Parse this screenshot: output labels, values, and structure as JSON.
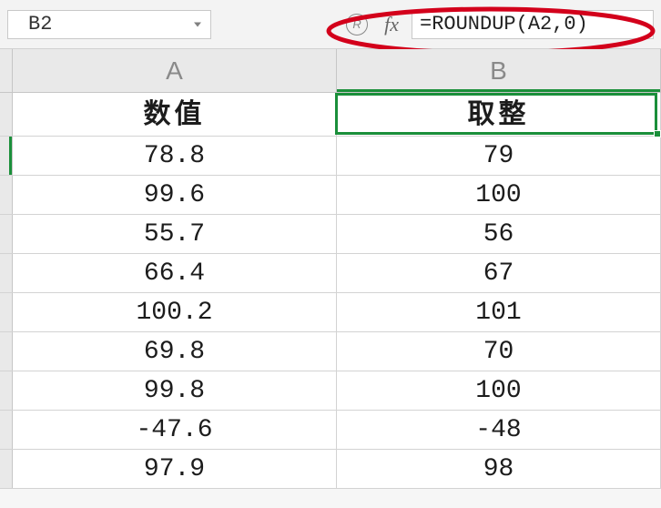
{
  "namebox": {
    "value": "B2"
  },
  "formula": {
    "value": "=ROUNDUP(A2,0)"
  },
  "icons": {
    "r": "R",
    "fx": "fx"
  },
  "columns": [
    "A",
    "B"
  ],
  "selected_column_index": 1,
  "selected_row_index": 1,
  "table_headers": {
    "A": "数值",
    "B": "取整"
  },
  "rows": [
    {
      "A": "78.8",
      "B": "79"
    },
    {
      "A": "99.6",
      "B": "100"
    },
    {
      "A": "55.7",
      "B": "56"
    },
    {
      "A": "66.4",
      "B": "67"
    },
    {
      "A": "100.2",
      "B": "101"
    },
    {
      "A": "69.8",
      "B": "70"
    },
    {
      "A": "99.8",
      "B": "100"
    },
    {
      "A": "-47.6",
      "B": "-48"
    },
    {
      "A": "97.9",
      "B": "98"
    }
  ],
  "chart_data": {
    "type": "table",
    "columns": [
      "数值",
      "取整"
    ],
    "data": [
      [
        78.8,
        79
      ],
      [
        99.6,
        100
      ],
      [
        55.7,
        56
      ],
      [
        66.4,
        67
      ],
      [
        100.2,
        101
      ],
      [
        69.8,
        70
      ],
      [
        99.8,
        100
      ],
      [
        -47.6,
        -48
      ],
      [
        97.9,
        98
      ]
    ],
    "formula_applied": "=ROUNDUP(A2,0)"
  }
}
